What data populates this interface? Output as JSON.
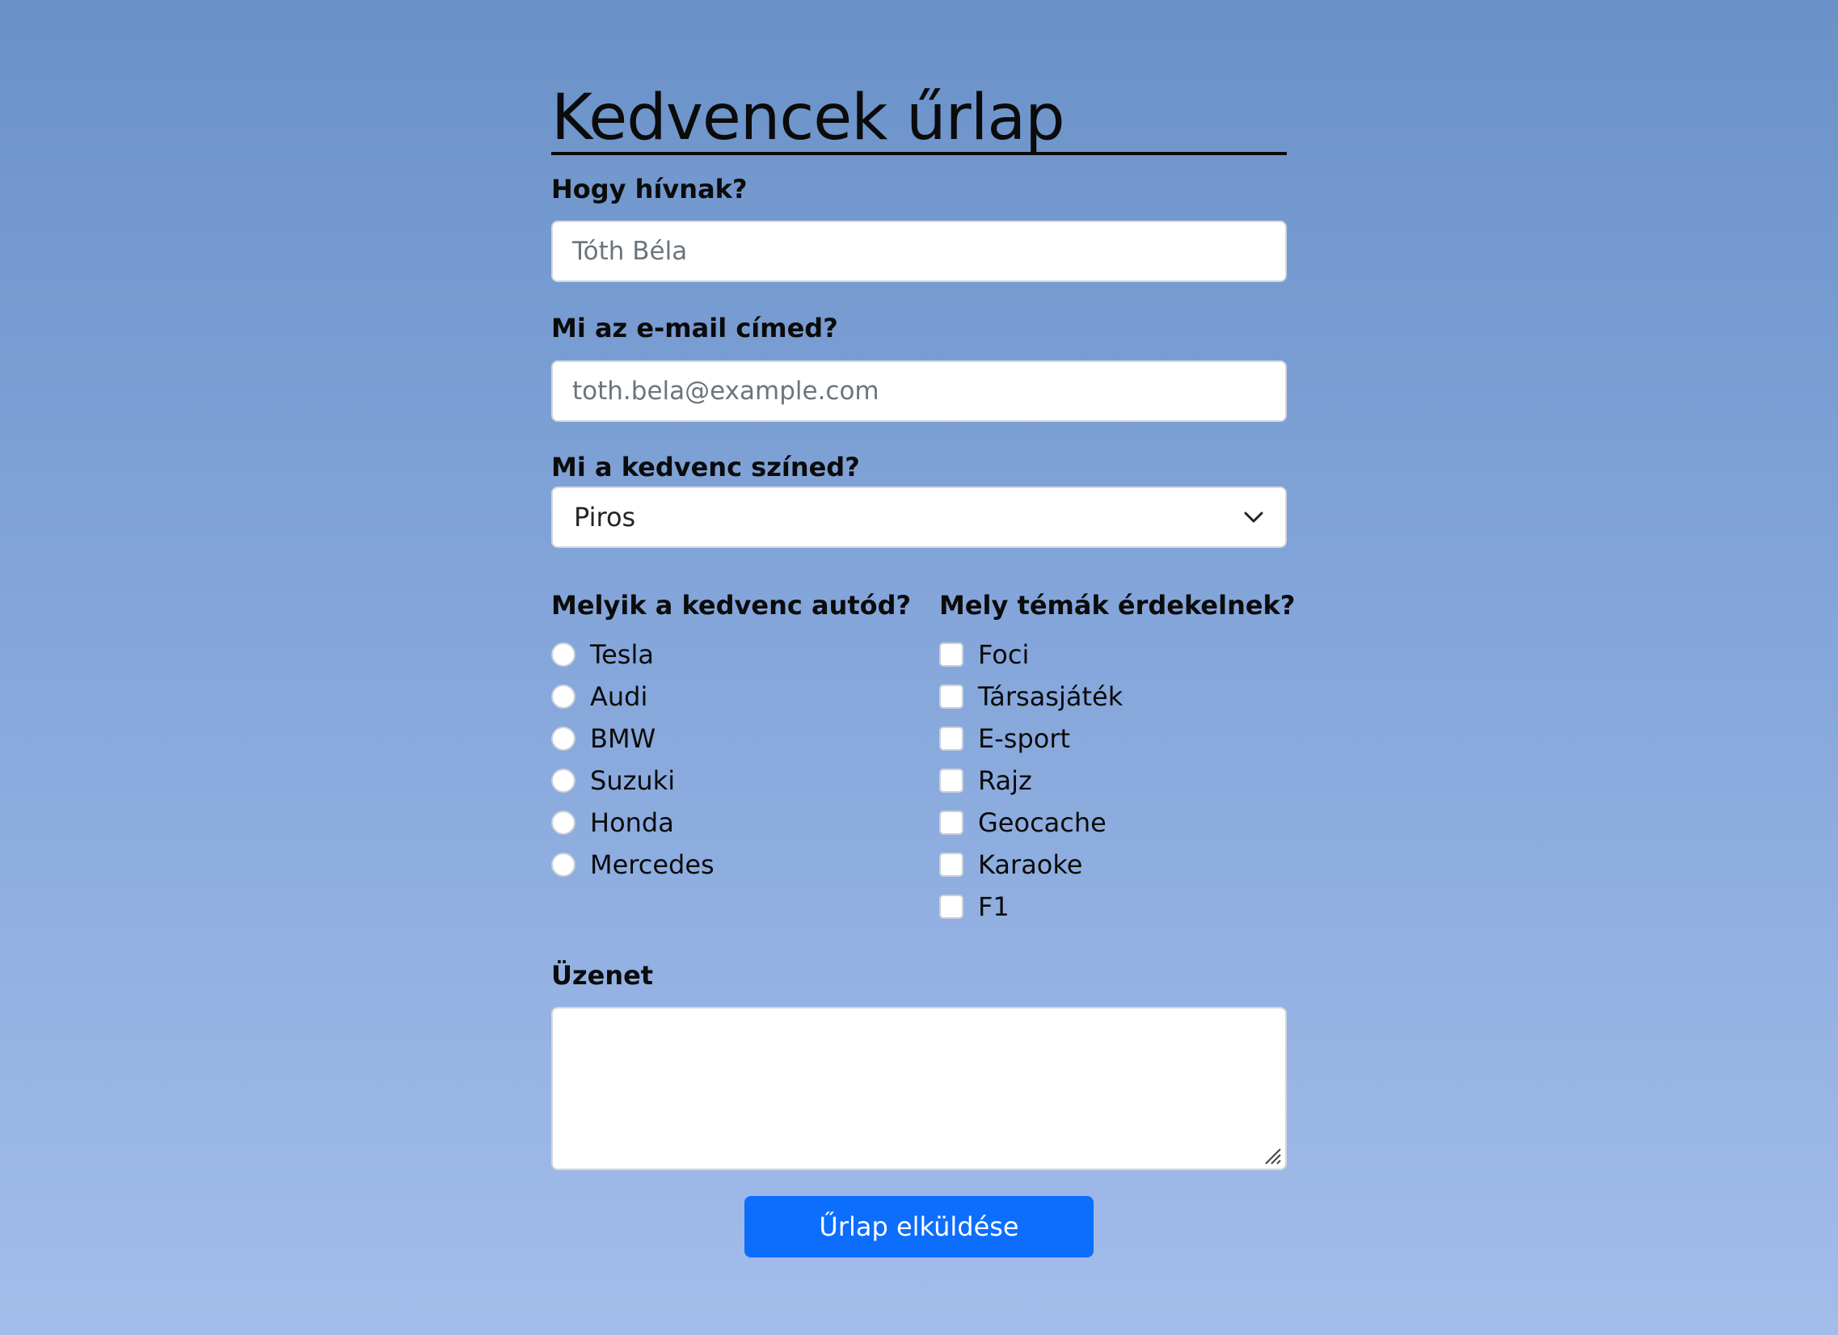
{
  "title": "Kedvencek űrlap",
  "name_field": {
    "label": "Hogy hívnak?",
    "placeholder": "Tóth Béla",
    "value": ""
  },
  "email_field": {
    "label": "Mi az e-mail címed?",
    "placeholder": "toth.bela@example.com",
    "value": ""
  },
  "color_field": {
    "label": "Mi a kedvenc színed?",
    "selected": "Piros"
  },
  "car_field": {
    "label": "Melyik a kedvenc autód?",
    "options": [
      "Tesla",
      "Audi",
      "BMW",
      "Suzuki",
      "Honda",
      "Mercedes"
    ]
  },
  "topics_field": {
    "label": "Mely témák érdekelnek?",
    "options": [
      "Foci",
      "Társasjáték",
      "E-sport",
      "Rajz",
      "Geocache",
      "Karaoke",
      "F1"
    ]
  },
  "message_field": {
    "label": "Üzenet",
    "value": ""
  },
  "submit_label": "Űrlap elküldése",
  "colors": {
    "accent": "#0d6efd",
    "background_top": "#6a92c8",
    "background_bottom": "#a3bdeb"
  }
}
